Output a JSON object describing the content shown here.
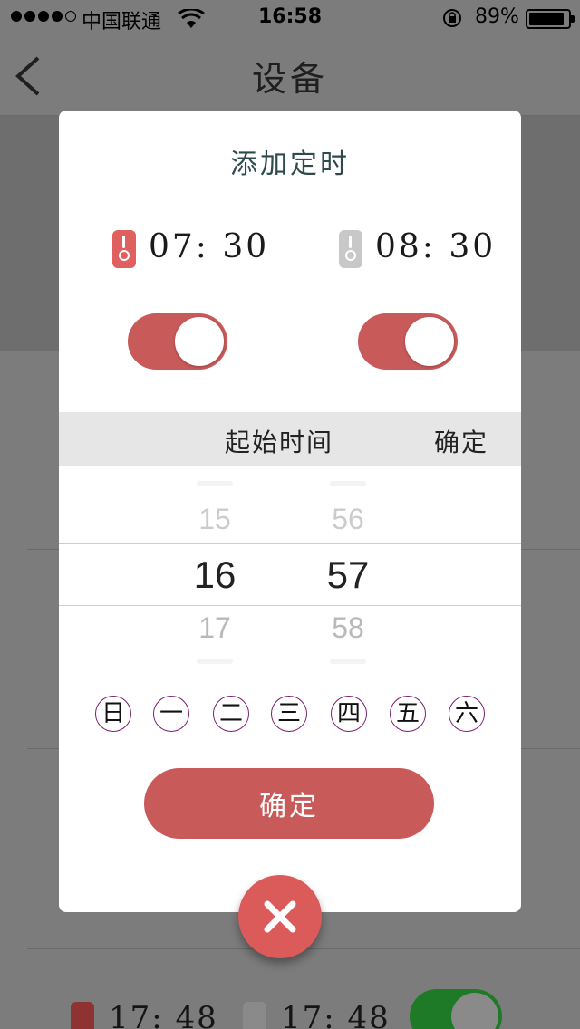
{
  "status_bar": {
    "carrier": "中国联通",
    "time": "16:58",
    "battery": "89%"
  },
  "nav": {
    "title": "设备"
  },
  "dialog": {
    "title": "添加定时",
    "start_time": "07: 30",
    "end_time": "08: 30",
    "start_icon": "thermometer-red-icon",
    "end_icon": "thermometer-gray-icon",
    "start_switch_on": true,
    "end_switch_on": true,
    "picker": {
      "label": "起始时间",
      "confirm": "确定",
      "hour_prev": "15",
      "hour_current": "16",
      "hour_next": "17",
      "minute_prev": "56",
      "minute_current": "57",
      "minute_next": "58"
    },
    "days": [
      "日",
      "一",
      "二",
      "三",
      "四",
      "五",
      "六"
    ],
    "confirm_button": "确定",
    "close_icon": "close-icon"
  },
  "background_row": {
    "start_time": "17: 48",
    "end_time": "17: 48",
    "switch_on": true
  },
  "colors": {
    "accent": "#c95a5a",
    "close_button": "#db5a5a",
    "overlay": "#7c7c7c",
    "bg_switch": "#1f7a28"
  }
}
